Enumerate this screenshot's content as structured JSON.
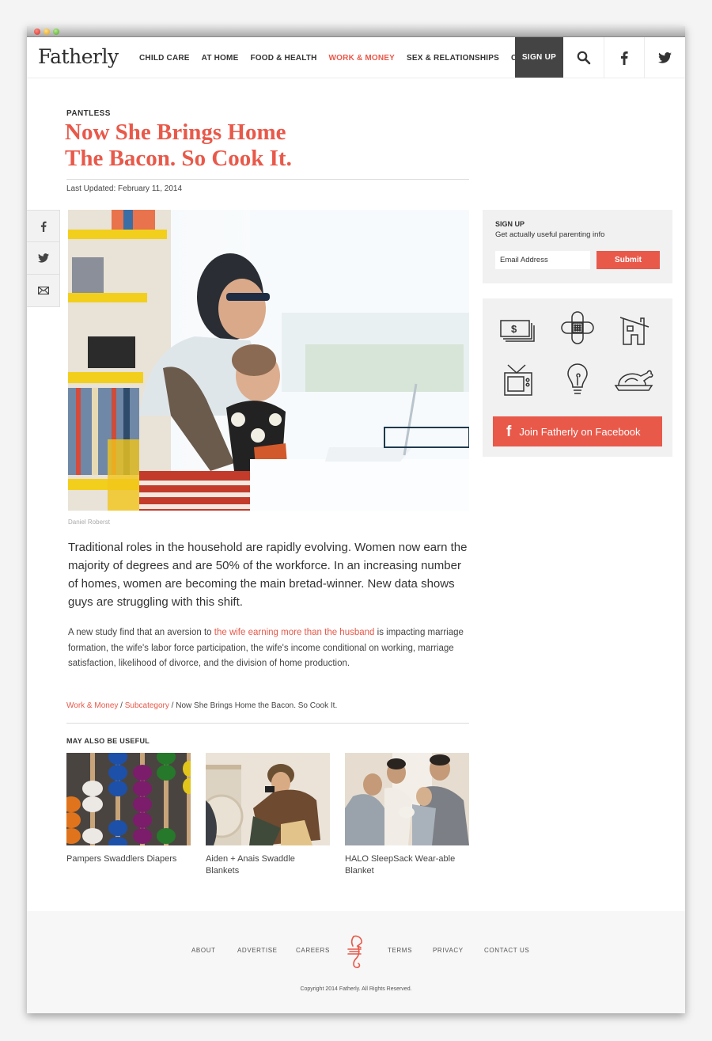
{
  "window": {
    "controls": [
      "close",
      "minimize",
      "zoom"
    ]
  },
  "header": {
    "logo": "Fatherly",
    "nav": [
      {
        "label": "CHILD CARE",
        "active": false
      },
      {
        "label": "AT HOME",
        "active": false
      },
      {
        "label": "FOOD & HEALTH",
        "active": false
      },
      {
        "label": "WORK & MONEY",
        "active": true
      },
      {
        "label": "SEX & RELATIONSHIPS",
        "active": false
      },
      {
        "label": "CULTURE",
        "active": false
      }
    ],
    "signup_label": "SIGN UP",
    "icons": [
      "search-icon",
      "facebook-icon",
      "twitter-icon"
    ]
  },
  "article": {
    "kicker": "PANTLESS",
    "title_line1": "Now She Brings Home",
    "title_line2": "The Bacon. So Cook It.",
    "updated": "Last Updated: February 11, 2014",
    "photo_credit": "Daniel Roberst",
    "lead": "Traditional roles in the household are rapidly evolving. Women now earn the majority of degrees and are 50% of the workforce. In an increasing number of homes, women are becoming the main bretad-winner. New data shows guys are struggling with this shift.",
    "body_before": "A new study find that an aversion to ",
    "body_link": "the wife earning more than the husband",
    "body_after": " is impacting marriage formation, the wife's labor force participation, the wife's income conditional on working, marriage satisfaction, likelihood of divorce, and the division of home production."
  },
  "share": [
    "facebook-icon",
    "twitter-icon",
    "email-icon"
  ],
  "breadcrumb": {
    "level1": "Work & Money",
    "level2": "Subcategory",
    "current": "Now She Brings Home the Bacon. So Cook It.",
    "separator": " / "
  },
  "related": {
    "title": "MAY ALSO BE USEFUL",
    "items": [
      {
        "label": "Pampers Swaddlers Diapers"
      },
      {
        "label": "Aiden + Anais Swaddle Blankets"
      },
      {
        "label": "HALO SleepSack Wear-able Blanket"
      }
    ]
  },
  "sidebar": {
    "signup": {
      "heading": "SIGN UP",
      "subheading": "Get actually useful parenting info",
      "email_placeholder": "Email Address",
      "submit_label": "Submit"
    },
    "facebook": {
      "icons": [
        "money-icon",
        "bandage-icon",
        "house-icon",
        "tv-icon",
        "lightbulb-icon",
        "turkey-icon"
      ],
      "f_glyph": "f",
      "join_label": "Join Fatherly on Facebook"
    }
  },
  "footer": {
    "links_left": [
      "ABOUT",
      "ADVERTISE",
      "CAREERS"
    ],
    "links_right": [
      "TERMS",
      "PRIVACY",
      "CONTACT US"
    ],
    "copyright": "Copyright 2014 Fatherly. All Rights Reserved."
  },
  "colors": {
    "accent": "#e8594a",
    "signup_bg": "#444444",
    "panel_bg": "#f1f1f1"
  }
}
